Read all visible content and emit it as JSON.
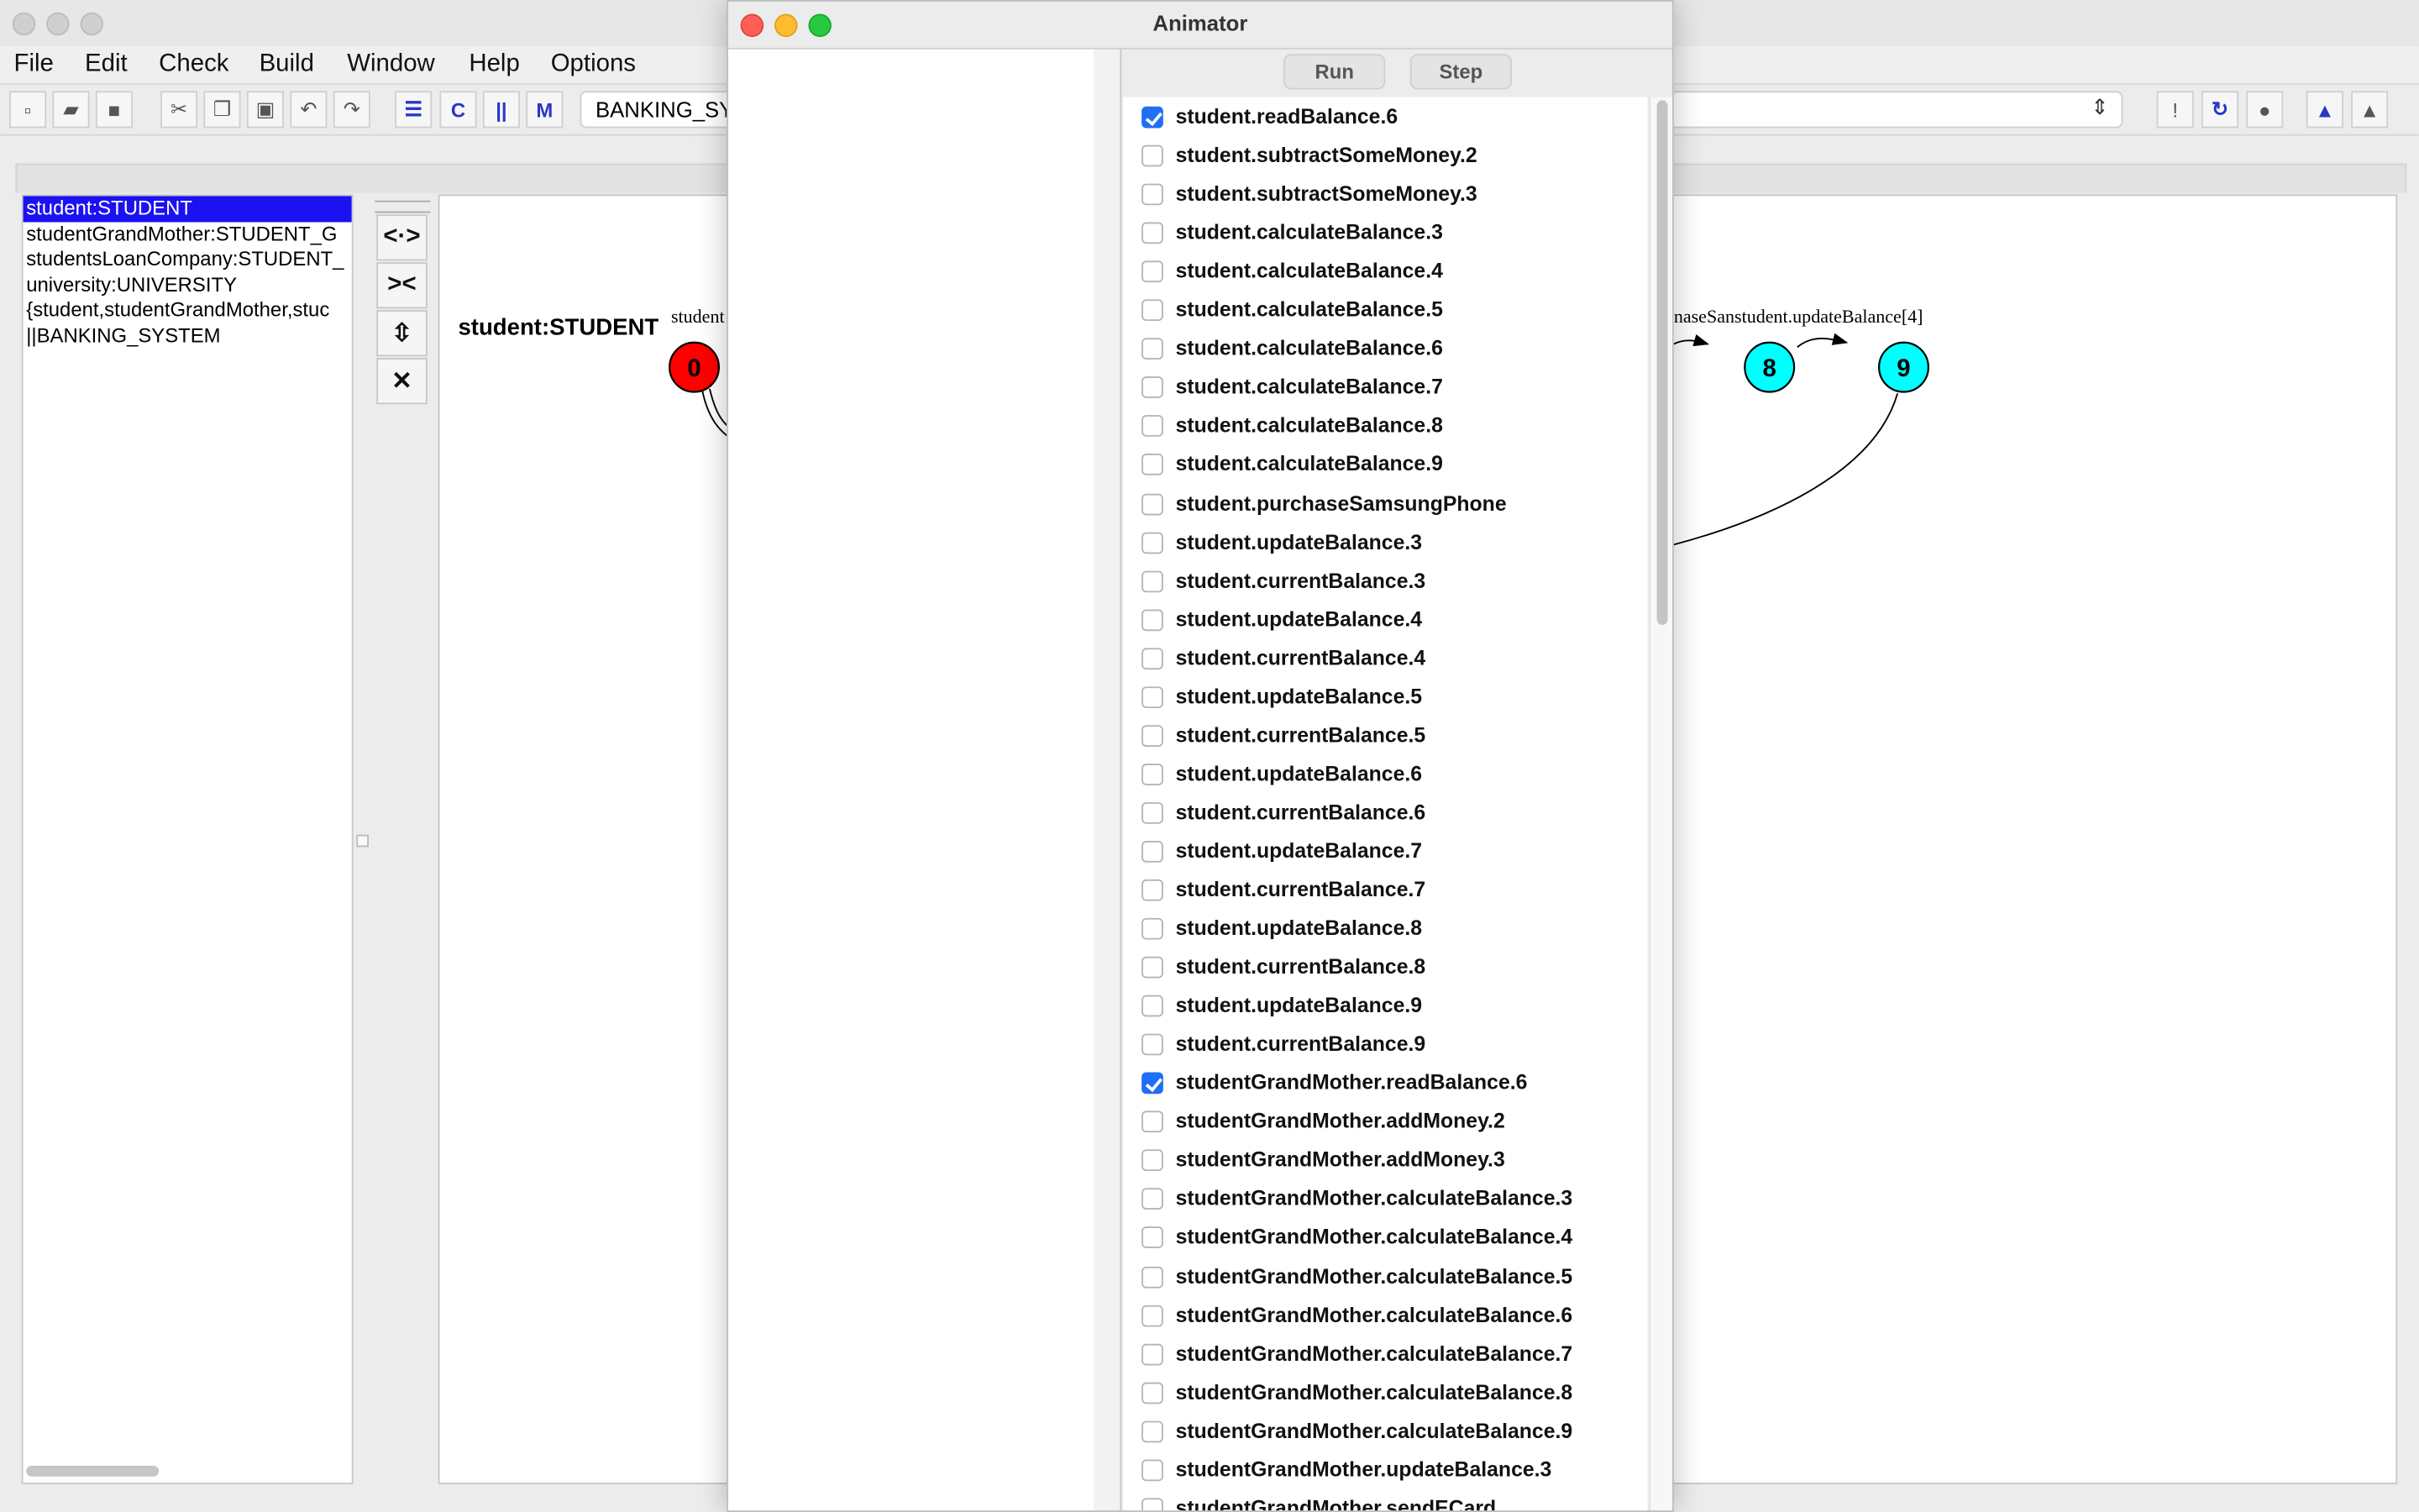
{
  "main_menu": [
    "File",
    "Edit",
    "Check",
    "Build",
    "Window",
    "Help",
    "Options"
  ],
  "toolbar": {
    "target_value": "BANKING_SY"
  },
  "process_list": [
    {
      "label": "student:STUDENT",
      "selected": true
    },
    {
      "label": "studentGrandMother:STUDENT_G",
      "selected": false
    },
    {
      "label": "studentsLoanCompany:STUDENT_",
      "selected": false
    },
    {
      "label": "university:UNIVERSITY",
      "selected": false
    },
    {
      "label": "{student,studentGrandMother,stuc",
      "selected": false
    },
    {
      "label": "||BANKING_SYSTEM",
      "selected": false
    }
  ],
  "canvas": {
    "process_title": "student:STUDENT",
    "edge_label_left": "student",
    "edge_label_right": "naseSanstudent.updateBalance[4]",
    "states": [
      "0",
      "8",
      "9"
    ],
    "colors": {
      "initial_state": "#ff0000",
      "state": "#00ffff"
    }
  },
  "animator": {
    "title": "Animator",
    "run_label": "Run",
    "step_label": "Step",
    "actions": [
      {
        "label": "student.readBalance.6",
        "checked": true
      },
      {
        "label": "student.subtractSomeMoney.2",
        "checked": false
      },
      {
        "label": "student.subtractSomeMoney.3",
        "checked": false
      },
      {
        "label": "student.calculateBalance.3",
        "checked": false
      },
      {
        "label": "student.calculateBalance.4",
        "checked": false
      },
      {
        "label": "student.calculateBalance.5",
        "checked": false
      },
      {
        "label": "student.calculateBalance.6",
        "checked": false
      },
      {
        "label": "student.calculateBalance.7",
        "checked": false
      },
      {
        "label": "student.calculateBalance.8",
        "checked": false
      },
      {
        "label": "student.calculateBalance.9",
        "checked": false
      },
      {
        "label": "student.purchaseSamsungPhone",
        "checked": false
      },
      {
        "label": "student.updateBalance.3",
        "checked": false
      },
      {
        "label": "student.currentBalance.3",
        "checked": false
      },
      {
        "label": "student.updateBalance.4",
        "checked": false
      },
      {
        "label": "student.currentBalance.4",
        "checked": false
      },
      {
        "label": "student.updateBalance.5",
        "checked": false
      },
      {
        "label": "student.currentBalance.5",
        "checked": false
      },
      {
        "label": "student.updateBalance.6",
        "checked": false
      },
      {
        "label": "student.currentBalance.6",
        "checked": false
      },
      {
        "label": "student.updateBalance.7",
        "checked": false
      },
      {
        "label": "student.currentBalance.7",
        "checked": false
      },
      {
        "label": "student.updateBalance.8",
        "checked": false
      },
      {
        "label": "student.currentBalance.8",
        "checked": false
      },
      {
        "label": "student.updateBalance.9",
        "checked": false
      },
      {
        "label": "student.currentBalance.9",
        "checked": false
      },
      {
        "label": "studentGrandMother.readBalance.6",
        "checked": true
      },
      {
        "label": "studentGrandMother.addMoney.2",
        "checked": false
      },
      {
        "label": "studentGrandMother.addMoney.3",
        "checked": false
      },
      {
        "label": "studentGrandMother.calculateBalance.3",
        "checked": false
      },
      {
        "label": "studentGrandMother.calculateBalance.4",
        "checked": false
      },
      {
        "label": "studentGrandMother.calculateBalance.5",
        "checked": false
      },
      {
        "label": "studentGrandMother.calculateBalance.6",
        "checked": false
      },
      {
        "label": "studentGrandMother.calculateBalance.7",
        "checked": false
      },
      {
        "label": "studentGrandMother.calculateBalance.8",
        "checked": false
      },
      {
        "label": "studentGrandMother.calculateBalance.9",
        "checked": false
      },
      {
        "label": "studentGrandMother.updateBalance.3",
        "checked": false
      },
      {
        "label": "studentGrandMother.sendECard",
        "checked": false
      }
    ]
  }
}
